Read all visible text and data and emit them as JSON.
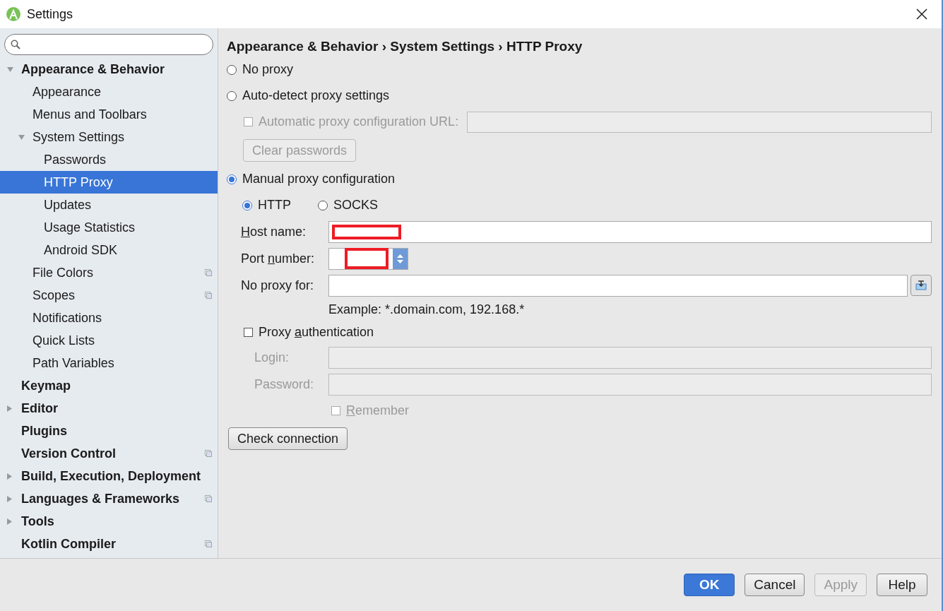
{
  "window": {
    "title": "Settings"
  },
  "sidebar": {
    "items": [
      {
        "label": "Appearance & Behavior",
        "expanded": true,
        "selected": false,
        "children": [
          {
            "label": "Appearance",
            "selected": false
          },
          {
            "label": "Menus and Toolbars",
            "selected": false
          },
          {
            "label": "System Settings",
            "expanded": true,
            "selected": false,
            "children": [
              {
                "label": "Passwords",
                "selected": false
              },
              {
                "label": "HTTP Proxy",
                "selected": true
              },
              {
                "label": "Updates",
                "selected": false
              },
              {
                "label": "Usage Statistics",
                "selected": false
              },
              {
                "label": "Android SDK",
                "selected": false
              }
            ]
          },
          {
            "label": "File Colors",
            "selected": false,
            "project_scoped": true
          },
          {
            "label": "Scopes",
            "selected": false,
            "project_scoped": true
          },
          {
            "label": "Notifications",
            "selected": false
          },
          {
            "label": "Quick Lists",
            "selected": false
          },
          {
            "label": "Path Variables",
            "selected": false
          }
        ]
      },
      {
        "label": "Keymap",
        "selected": false
      },
      {
        "label": "Editor",
        "expanded": false,
        "selected": false
      },
      {
        "label": "Plugins",
        "selected": false
      },
      {
        "label": "Version Control",
        "selected": false,
        "project_scoped": true
      },
      {
        "label": "Build, Execution, Deployment",
        "expanded": false,
        "selected": false
      },
      {
        "label": "Languages & Frameworks",
        "expanded": false,
        "selected": false,
        "project_scoped": true
      },
      {
        "label": "Tools",
        "expanded": false,
        "selected": false
      },
      {
        "label": "Kotlin Compiler",
        "selected": false,
        "project_scoped": true
      }
    ]
  },
  "breadcrumb": [
    "Appearance & Behavior",
    "System Settings",
    "HTTP Proxy"
  ],
  "breadcrumb_separator": "›",
  "proxy_modes": [
    {
      "label": "No proxy",
      "selected": false
    },
    {
      "label": "Auto-detect proxy settings",
      "selected": false
    },
    {
      "label": "Manual proxy configuration",
      "selected": true
    }
  ],
  "auto_config": {
    "label": "Automatic proxy configuration URL:",
    "checked": false,
    "disabled": true
  },
  "clear_passwords": {
    "label": "Clear passwords",
    "disabled": true
  },
  "protocols": [
    {
      "label": "HTTP",
      "selected": true
    },
    {
      "label": "SOCKS",
      "selected": false
    }
  ],
  "host": {
    "label": {
      "key": "H",
      "post": "ost name:"
    },
    "redacted": true
  },
  "port": {
    "label": {
      "pre": "Port ",
      "key": "n",
      "post": "umber:"
    },
    "redacted": true
  },
  "no_proxy": {
    "label": "No proxy for:",
    "example": "Example: *.domain.com, 192.168.*"
  },
  "auth": {
    "label": {
      "pre": "Proxy ",
      "key": "a",
      "post": "uthentication"
    },
    "checked": false
  },
  "login": {
    "label": "Login:",
    "disabled": true
  },
  "password": {
    "label": "Password:",
    "disabled": true
  },
  "remember": {
    "label": {
      "key": "R",
      "post": "emember"
    },
    "checked": false,
    "disabled": true
  },
  "check_connection": "Check connection",
  "buttons": [
    {
      "label": "OK",
      "kind": "primary",
      "disabled": false
    },
    {
      "label": "Cancel",
      "kind": "normal",
      "disabled": false
    },
    {
      "label": "Apply",
      "kind": "normal",
      "disabled": true
    },
    {
      "label": "Help",
      "kind": "normal",
      "disabled": false
    }
  ]
}
